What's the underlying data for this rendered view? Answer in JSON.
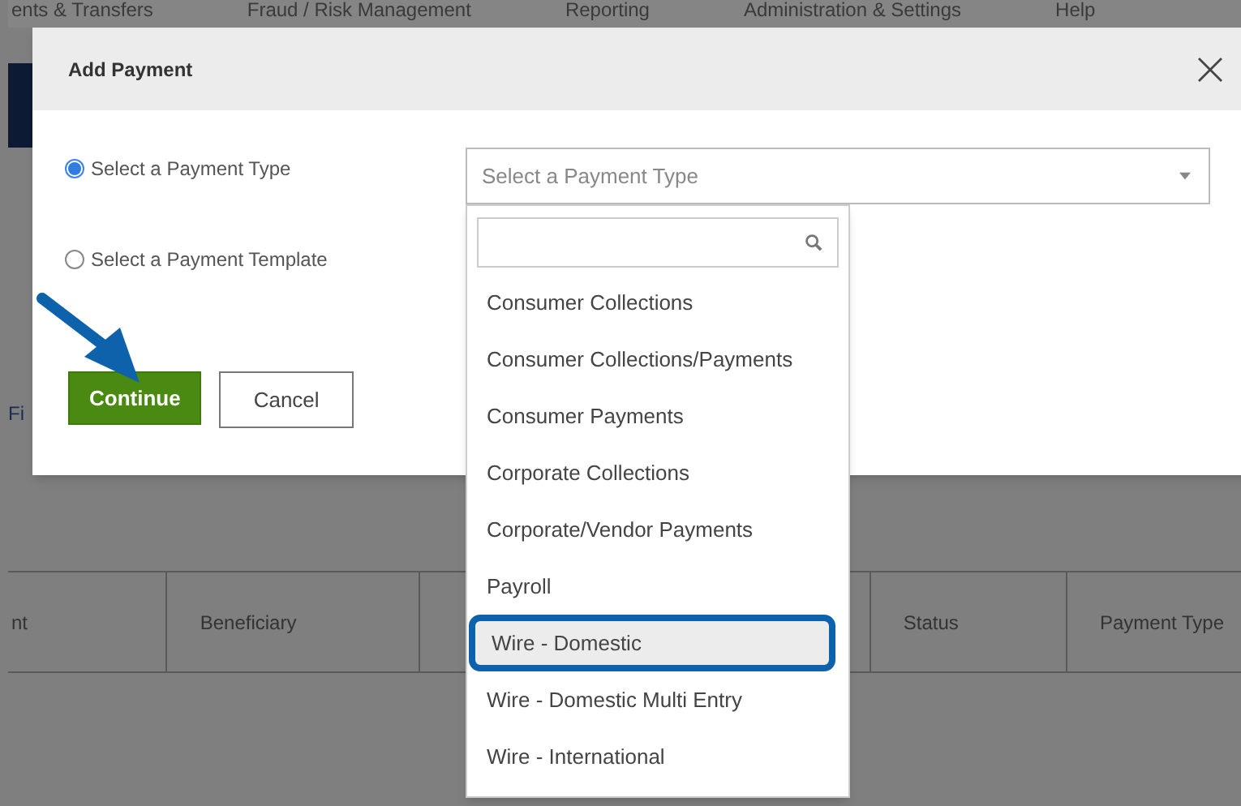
{
  "nav": [
    "ents & Transfers",
    "Fraud / Risk Management",
    "Reporting",
    "Administration & Settings",
    "Help"
  ],
  "background_label": "Fi",
  "table": {
    "columns": [
      "nt",
      "Beneficiary",
      "",
      "",
      "Status",
      "Payment Type"
    ]
  },
  "dialog": {
    "title": "Add Payment",
    "options": [
      {
        "label": "Select a Payment Type",
        "selected": true
      },
      {
        "label": "Select a Payment Template",
        "selected": false
      }
    ],
    "select": {
      "placeholder": "Select a Payment Type"
    },
    "dropdown": {
      "items": [
        {
          "label": "Consumer Collections",
          "selected": false
        },
        {
          "label": "Consumer Collections/Payments",
          "selected": false
        },
        {
          "label": "Consumer Payments",
          "selected": false
        },
        {
          "label": "Corporate Collections",
          "selected": false
        },
        {
          "label": "Corporate/Vendor Payments",
          "selected": false
        },
        {
          "label": "Payroll",
          "selected": false
        },
        {
          "label": "Wire - Domestic",
          "selected": true
        },
        {
          "label": "Wire - Domestic Multi Entry",
          "selected": false
        },
        {
          "label": "Wire - International",
          "selected": false
        }
      ]
    },
    "buttons": [
      {
        "label": "Continue",
        "kind": "primary"
      },
      {
        "label": "Cancel",
        "kind": "secondary"
      }
    ]
  }
}
